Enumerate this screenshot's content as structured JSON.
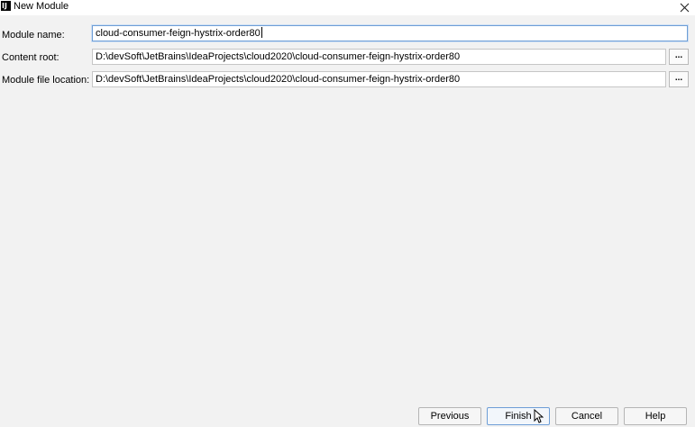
{
  "window": {
    "title": "New Module",
    "app_icon_text": "IJ"
  },
  "form": {
    "module_name": {
      "label": "Module name:",
      "value": "cloud-consumer-feign-hystrix-order80"
    },
    "content_root": {
      "label": "Content root:",
      "value": "D:\\devSoft\\JetBrains\\IdeaProjects\\cloud2020\\cloud-consumer-feign-hystrix-order80",
      "browse_label": "..."
    },
    "module_file_location": {
      "label": "Module file location:",
      "value": "D:\\devSoft\\JetBrains\\IdeaProjects\\cloud2020\\cloud-consumer-feign-hystrix-order80",
      "browse_label": "..."
    }
  },
  "buttons": {
    "previous": "Previous",
    "finish": "Finish",
    "cancel": "Cancel",
    "help": "Help"
  },
  "icons": {
    "app": "intellij-icon",
    "close": "close-icon",
    "cursor": "mouse-pointer-icon"
  }
}
